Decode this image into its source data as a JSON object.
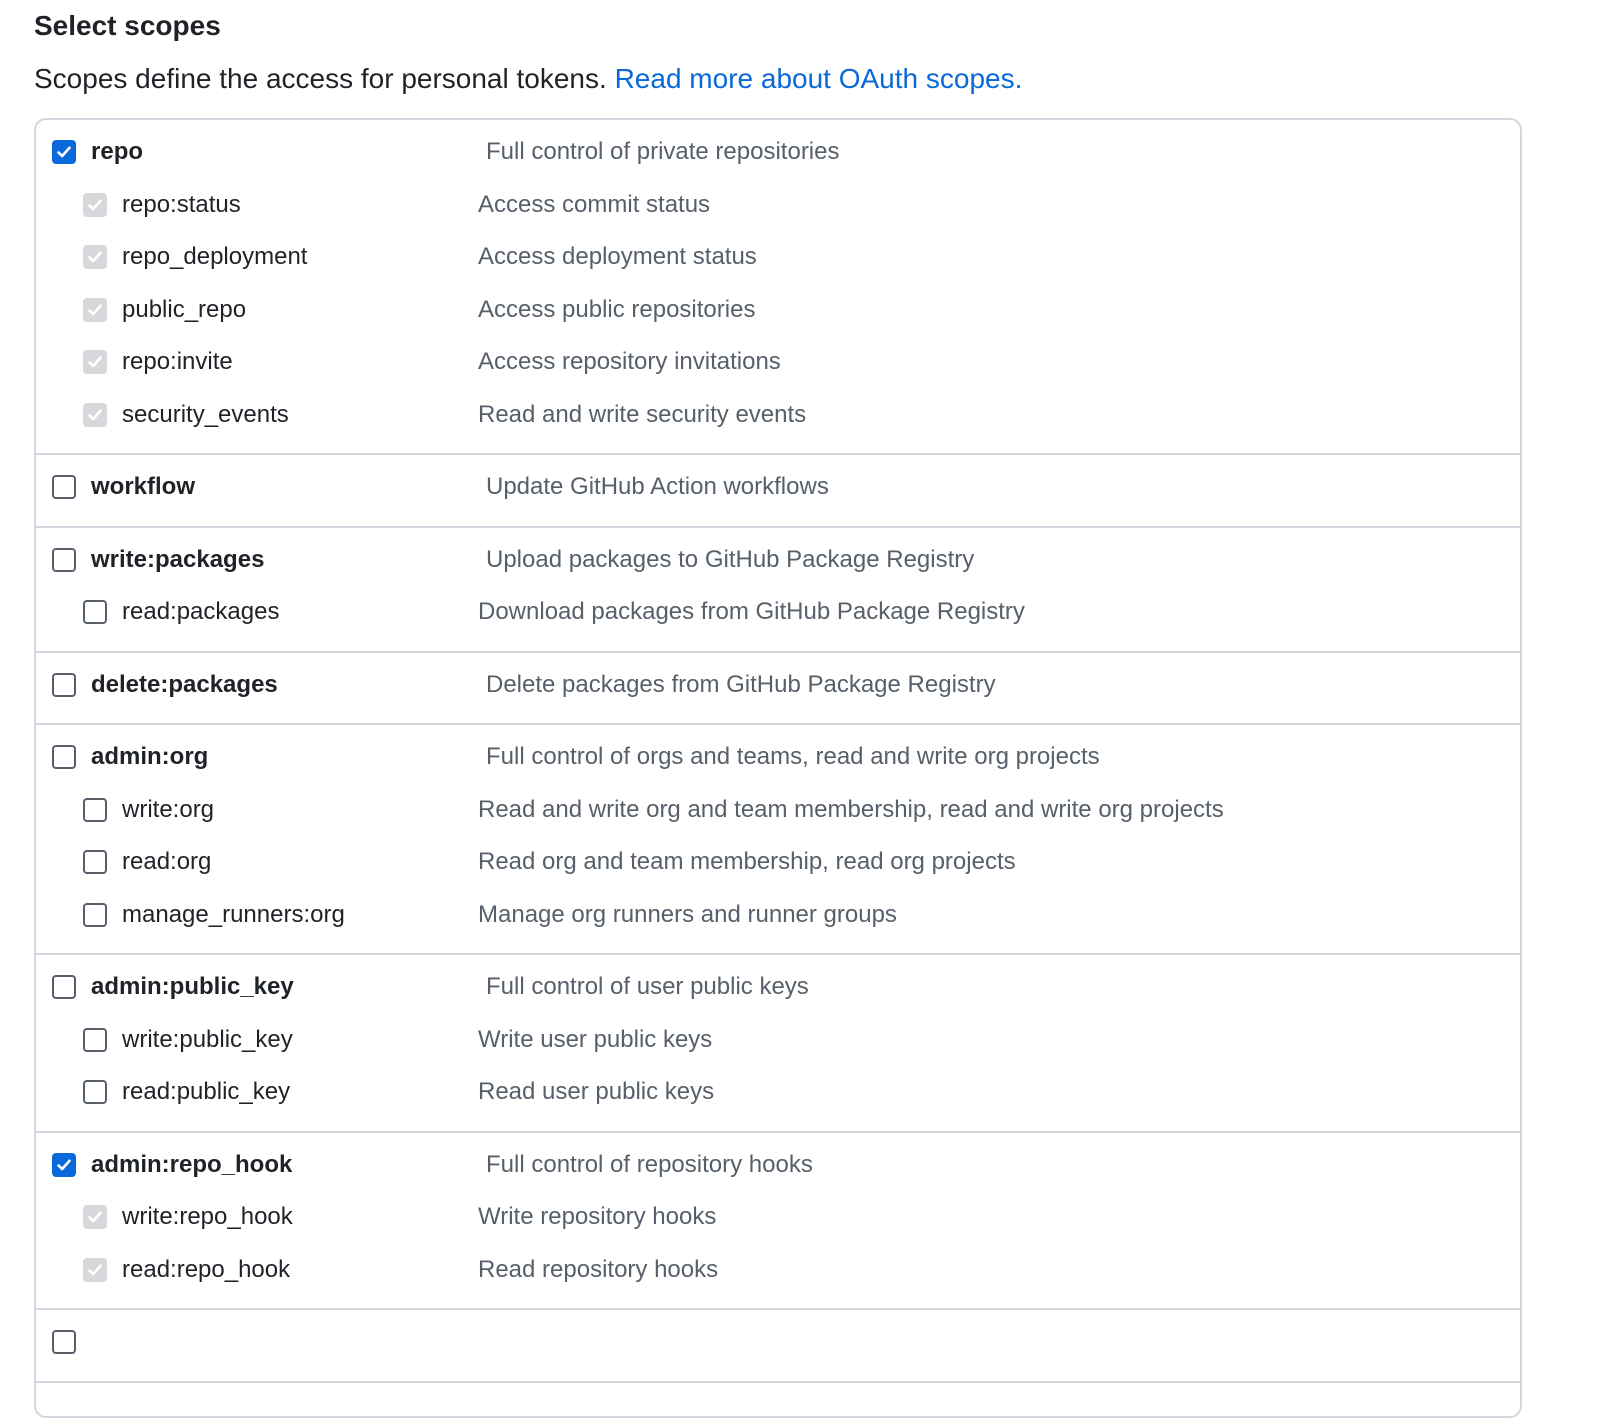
{
  "header": {
    "title": "Select scopes",
    "intro_text": "Scopes define the access for personal tokens.",
    "intro_link": "Read more about OAuth scopes."
  },
  "groups": [
    {
      "parent": {
        "name": "repo",
        "description": "Full control of private repositories",
        "checked": true
      },
      "children": [
        {
          "name": "repo:status",
          "description": "Access commit status",
          "state": "checked-disabled"
        },
        {
          "name": "repo_deployment",
          "description": "Access deployment status",
          "state": "checked-disabled"
        },
        {
          "name": "public_repo",
          "description": "Access public repositories",
          "state": "checked-disabled"
        },
        {
          "name": "repo:invite",
          "description": "Access repository invitations",
          "state": "checked-disabled"
        },
        {
          "name": "security_events",
          "description": "Read and write security events",
          "state": "checked-disabled"
        }
      ]
    },
    {
      "parent": {
        "name": "workflow",
        "description": "Update GitHub Action workflows",
        "checked": false
      },
      "children": []
    },
    {
      "parent": {
        "name": "write:packages",
        "description": "Upload packages to GitHub Package Registry",
        "checked": false
      },
      "children": [
        {
          "name": "read:packages",
          "description": "Download packages from GitHub Package Registry",
          "state": "unchecked"
        }
      ]
    },
    {
      "parent": {
        "name": "delete:packages",
        "description": "Delete packages from GitHub Package Registry",
        "checked": false
      },
      "children": []
    },
    {
      "parent": {
        "name": "admin:org",
        "description": "Full control of orgs and teams, read and write org projects",
        "checked": false
      },
      "children": [
        {
          "name": "write:org",
          "description": "Read and write org and team membership, read and write org projects",
          "state": "unchecked"
        },
        {
          "name": "read:org",
          "description": "Read org and team membership, read org projects",
          "state": "unchecked"
        },
        {
          "name": "manage_runners:org",
          "description": "Manage org runners and runner groups",
          "state": "unchecked"
        }
      ]
    },
    {
      "parent": {
        "name": "admin:public_key",
        "description": "Full control of user public keys",
        "checked": false
      },
      "children": [
        {
          "name": "write:public_key",
          "description": "Write user public keys",
          "state": "unchecked"
        },
        {
          "name": "read:public_key",
          "description": "Read user public keys",
          "state": "unchecked"
        }
      ]
    },
    {
      "parent": {
        "name": "admin:repo_hook",
        "description": "Full control of repository hooks",
        "checked": true
      },
      "children": [
        {
          "name": "write:repo_hook",
          "description": "Write repository hooks",
          "state": "checked-disabled"
        },
        {
          "name": "read:repo_hook",
          "description": "Read repository hooks",
          "state": "checked-disabled"
        }
      ]
    },
    {
      "parent": {
        "name": "",
        "description": "",
        "checked": false
      },
      "children": []
    }
  ]
}
